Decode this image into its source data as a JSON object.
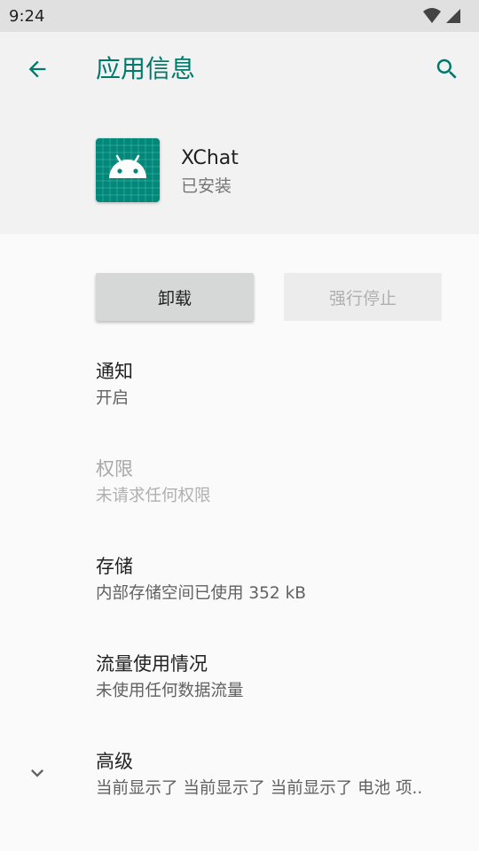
{
  "status_bar": {
    "time": "9:24"
  },
  "toolbar": {
    "title": "应用信息"
  },
  "app": {
    "name": "XChat",
    "status": "已安装"
  },
  "buttons": {
    "uninstall": "卸载",
    "force_stop": "强行停止"
  },
  "prefs": [
    {
      "title": "通知",
      "summary": "开启"
    },
    {
      "title": "权限",
      "summary": "未请求任何权限"
    },
    {
      "title": "存储",
      "summary": "内部存储空间已使用 352 kB"
    },
    {
      "title": "流量使用情况",
      "summary": "未使用任何数据流量"
    },
    {
      "title": "高级",
      "summary": "当前显示了 当前显示了 当前显示了 电池 项.."
    }
  ],
  "colors": {
    "accent": "#00796b",
    "app_icon_bg": "#00897b"
  },
  "icons": [
    "wifi-icon",
    "cell-signal-icon",
    "back-arrow-icon",
    "search-icon",
    "android-icon",
    "chevron-down-icon"
  ]
}
